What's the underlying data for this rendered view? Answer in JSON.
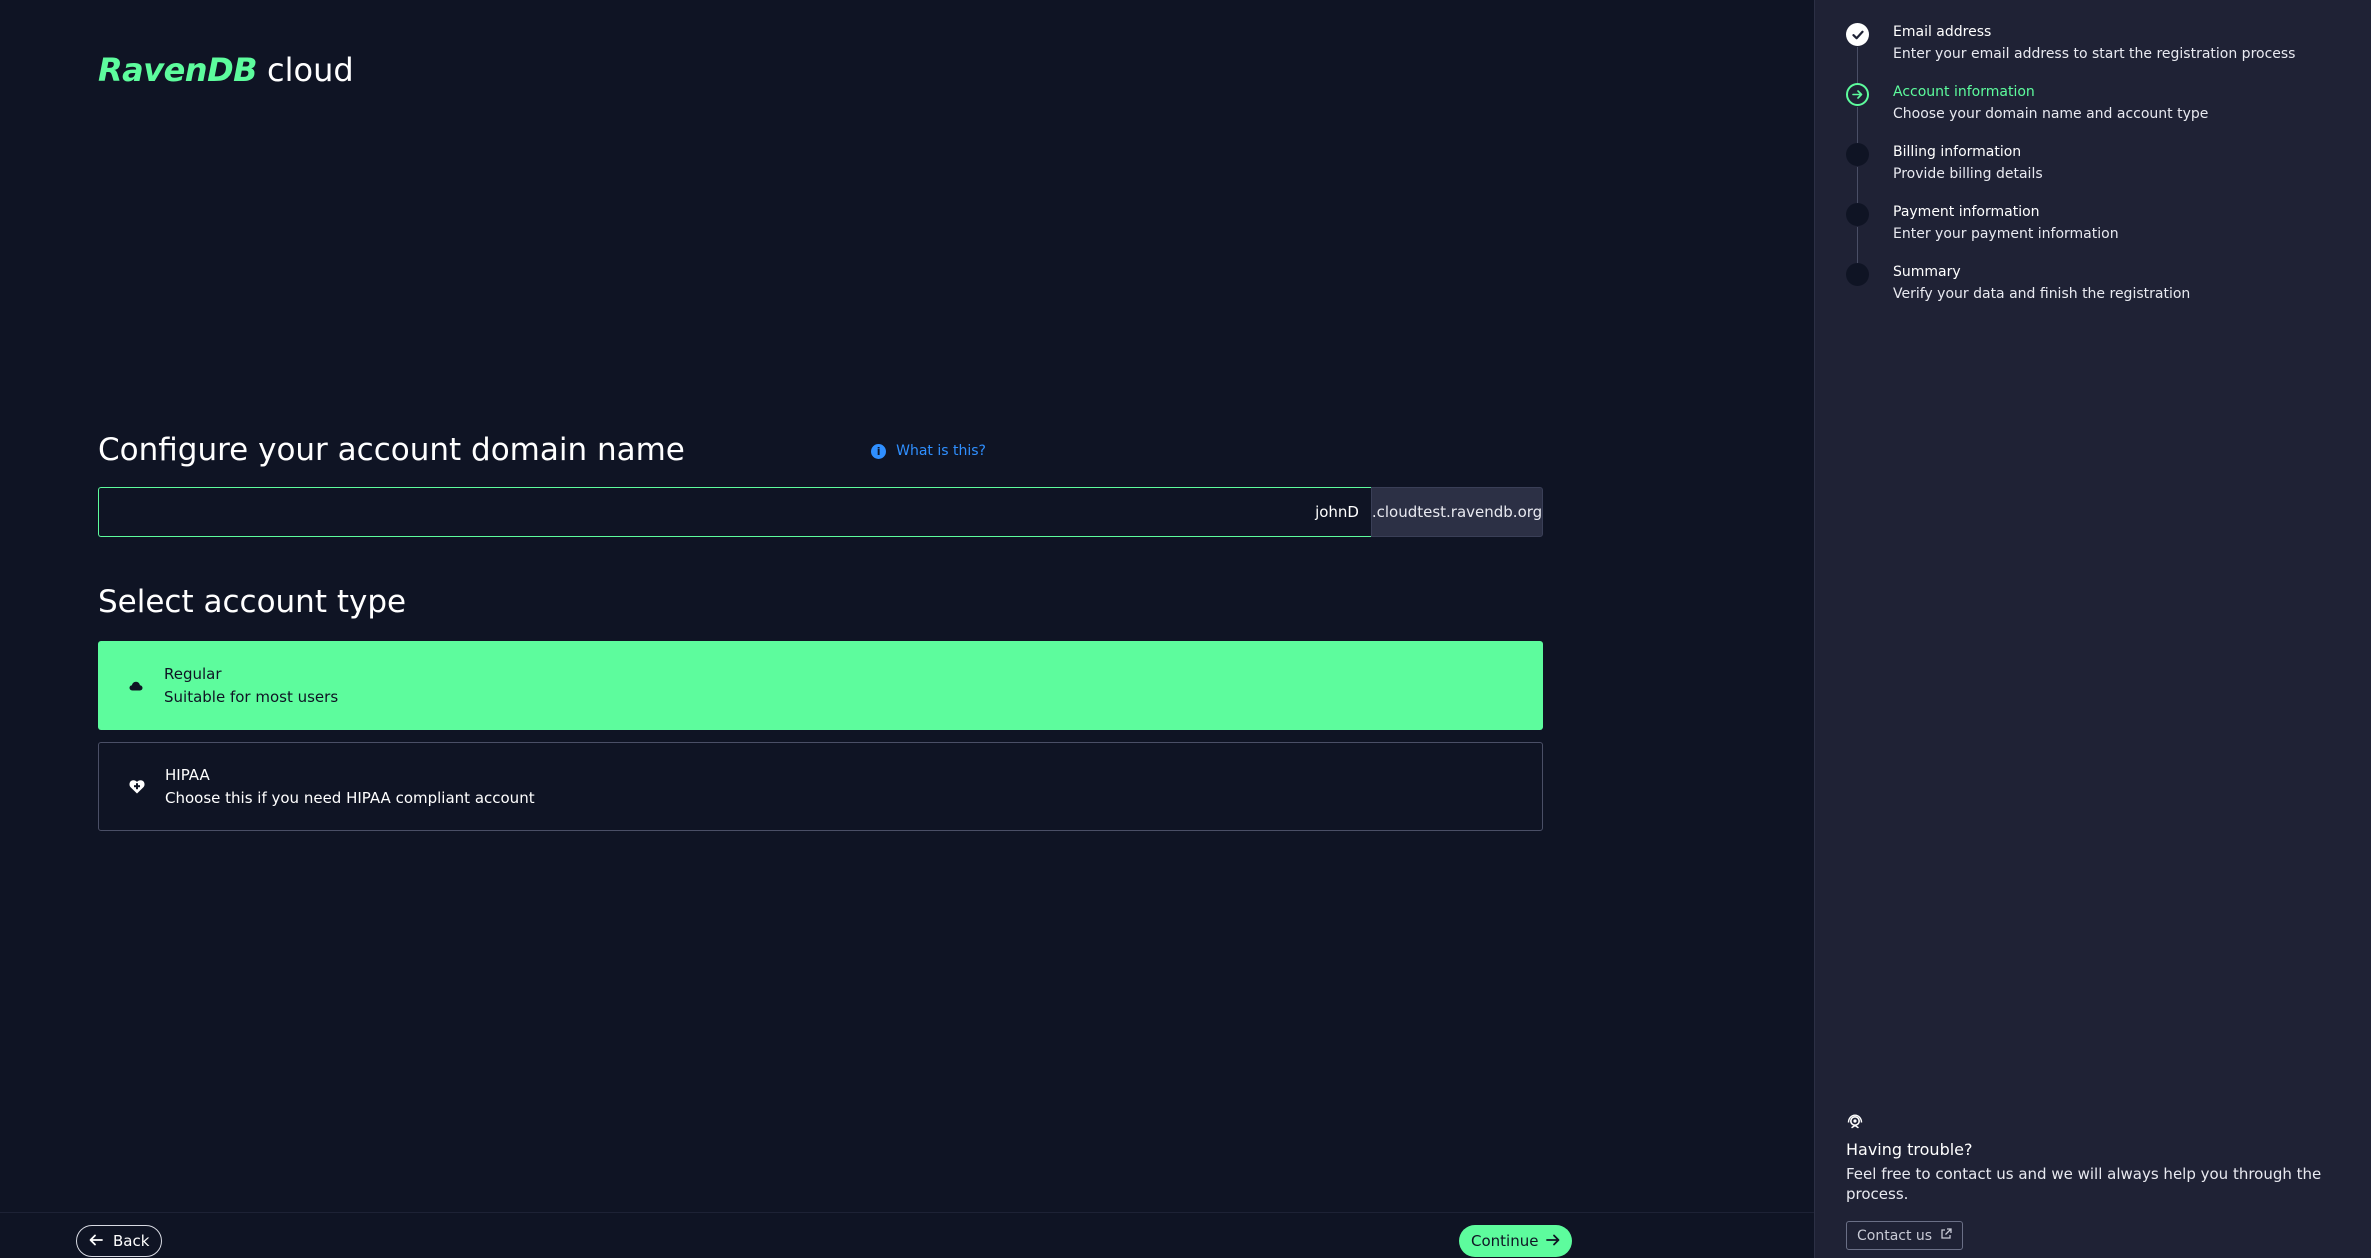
{
  "logo": {
    "brand": "RavenDB",
    "suffix": "cloud"
  },
  "domain": {
    "title": "Configure your account domain name",
    "help_link": "What is this?",
    "input_value": "johnD",
    "suffix": ".cloudtest.ravendb.org"
  },
  "account_type": {
    "title": "Select account type",
    "options": [
      {
        "name": "Regular",
        "description": "Suitable for most users",
        "icon": "cloud-icon",
        "selected": true
      },
      {
        "name": "HIPAA",
        "description": "Choose this if you need HIPAA compliant account",
        "icon": "heart-plus-icon",
        "selected": false
      }
    ]
  },
  "footer": {
    "back_label": "Back",
    "continue_label": "Continue"
  },
  "steps": [
    {
      "title": "Email address",
      "description": "Enter your email address to start the registration process",
      "state": "done"
    },
    {
      "title": "Account information",
      "description": "Choose your domain name and account type",
      "state": "current"
    },
    {
      "title": "Billing information",
      "description": "Provide billing details",
      "state": "pending"
    },
    {
      "title": "Payment information",
      "description": "Enter your payment information",
      "state": "pending"
    },
    {
      "title": "Summary",
      "description": "Verify your data and finish the registration",
      "state": "pending"
    }
  ],
  "help": {
    "title": "Having trouble?",
    "text": "Feel free to contact us and we will always help you through the process.",
    "contact_label": "Contact us"
  },
  "colors": {
    "accent": "#5dfc9d",
    "background": "#0f1424",
    "sidebar": "#1f2235",
    "link": "#2f8fff"
  }
}
